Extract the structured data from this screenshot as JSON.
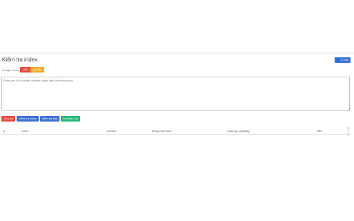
{
  "page": {
    "title": "Kiểm tra index",
    "top_button": {
      "icon": "user-icon",
      "label": "Ủ Hạn"
    }
  },
  "filters": {
    "source_label": "Google Search",
    "pill_red": "URL",
    "pill_orange": "Ip/URL"
  },
  "input": {
    "placeholder": "Enter you Url includes domain name (http://domain.com)"
  },
  "actions": {
    "delete": "Tải Link",
    "check_index": "Kiểm tra index",
    "check_link": "Kiểm tra link",
    "export": "Xuất file Csv"
  },
  "table": {
    "columns": [
      "#",
      "Links",
      "Indexed",
      "Response code",
      "Indexing capability",
      "Title"
    ]
  },
  "colors": {
    "blue": "#3b6fd1",
    "red": "#e24b3b",
    "orange": "#f0ad2a",
    "green": "#23b77a"
  }
}
